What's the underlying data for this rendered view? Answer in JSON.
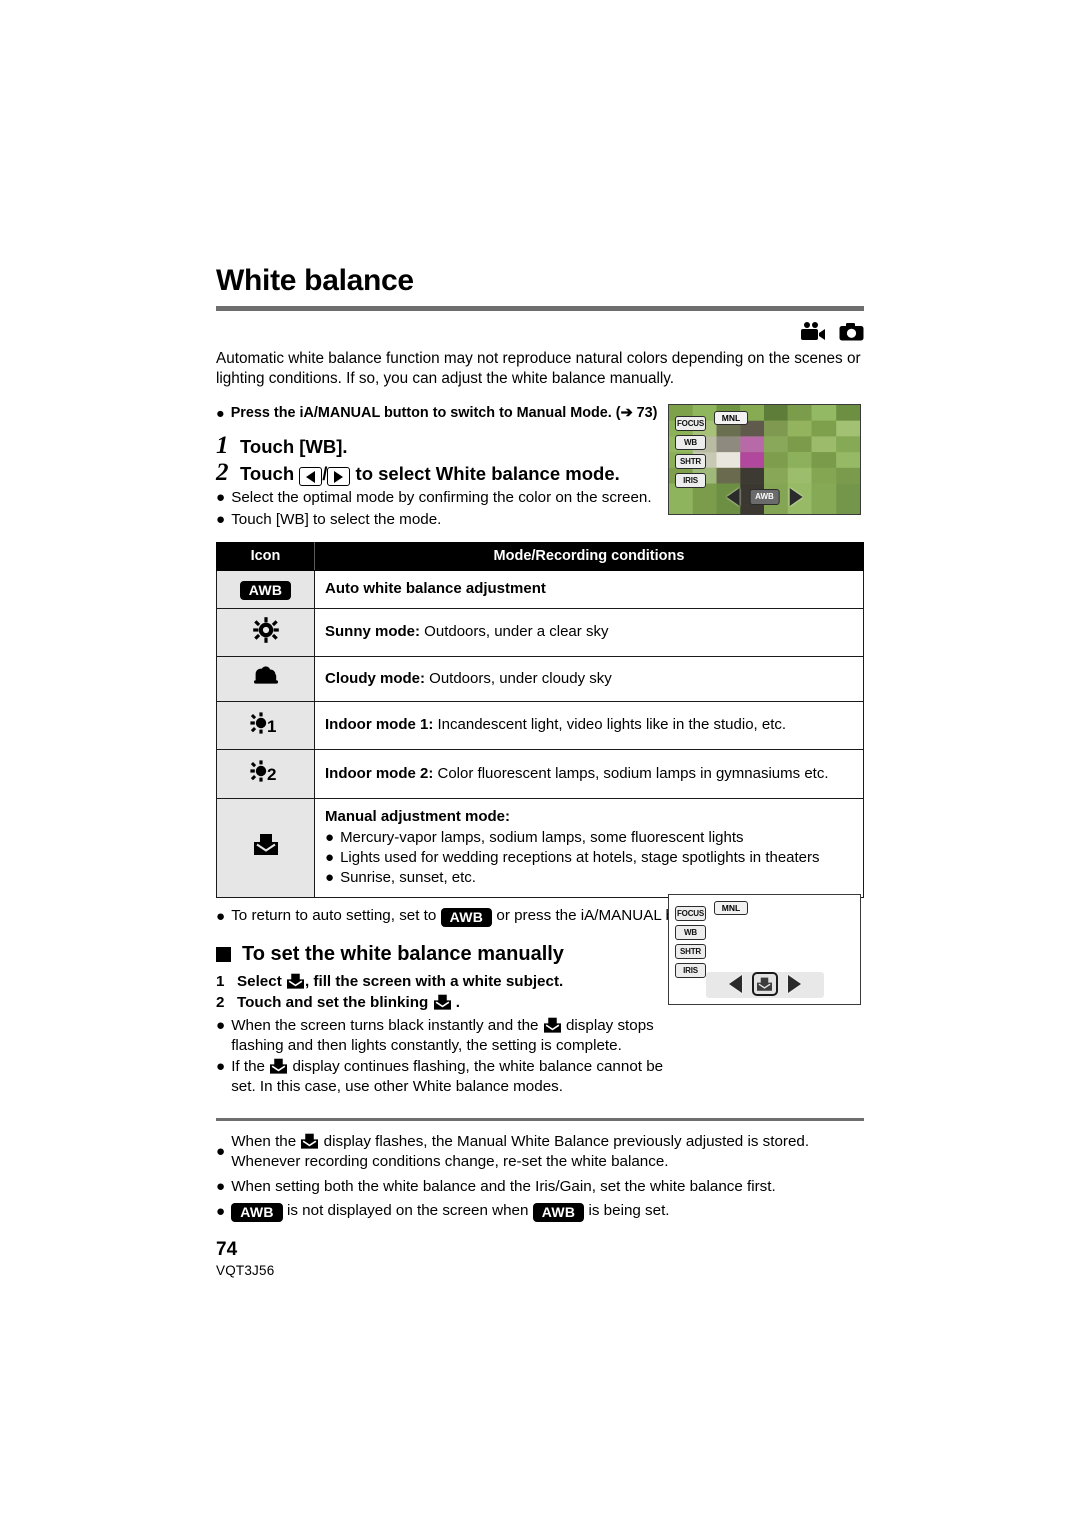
{
  "heading": {
    "title": "White balance"
  },
  "mode_icons": [
    {
      "name": "camcorder-icon",
      "label": "Motion picture recording mode"
    },
    {
      "name": "still-camera-icon",
      "label": "Still picture recording mode"
    }
  ],
  "intro": {
    "paragraph": "Automatic white balance function may not reproduce natural colors depending on the scenes or lighting conditions. If so, you can adjust the white balance manually.",
    "bullet": "Press the iA/MANUAL button to switch to Manual Mode.",
    "bullet_arrow": "➔",
    "bullet_page_ref": "73",
    "bullet_ref_open": "(",
    "bullet_ref_close": ")"
  },
  "steps": [
    {
      "num": "1",
      "text_before": "Touch [WB].",
      "text_after": ""
    },
    {
      "num": "2",
      "text_before": "Touch",
      "text_mid": "/",
      "text_after": "to select White balance mode."
    }
  ],
  "step_bullets": [
    "Select the optimal mode by confirming the color on the screen.",
    "Touch [WB] to select the mode."
  ],
  "lcd_screen_1": {
    "side_buttons": [
      "FOCUS",
      "WB",
      "SHTR",
      "IRIS"
    ],
    "mode_label": "MNL",
    "nav_left": "left-arrow",
    "nav_center": "AWB",
    "nav_right": "right-arrow"
  },
  "lcd_screen_2": {
    "side_buttons": [
      "FOCUS",
      "WB",
      "SHTR",
      "IRIS"
    ],
    "mode_label": "MNL",
    "nav_left": "left-arrow",
    "nav_center": "manual-wb-icon",
    "nav_right": "right-arrow"
  },
  "table": {
    "headers": {
      "icon": "Icon",
      "mode": "Mode/Recording conditions"
    },
    "rows": [
      {
        "icon_name": "awb-badge-icon",
        "icon_text": "AWB",
        "bold": "Auto white balance adjustment",
        "normal": ""
      },
      {
        "icon_name": "sunny-icon",
        "icon_text": "",
        "bold": "Sunny mode:",
        "normal": " Outdoors, under a clear sky"
      },
      {
        "icon_name": "cloudy-icon",
        "icon_text": "",
        "bold": "Cloudy mode:",
        "normal": " Outdoors, under cloudy sky"
      },
      {
        "icon_name": "indoor-mode-1-icon",
        "icon_text": "1",
        "bold": "Indoor mode 1:",
        "normal": " Incandescent light, video lights like in the studio, etc."
      },
      {
        "icon_name": "indoor-mode-2-icon",
        "icon_text": "2",
        "bold": "Indoor mode 2:",
        "normal": " Color fluorescent lamps, sodium lamps in gymnasiums etc."
      },
      {
        "icon_name": "manual-adjustment-icon",
        "icon_text": "",
        "bold": "Manual adjustment mode:",
        "normal": "",
        "sub_items": [
          "Mercury-vapor lamps, sodium lamps, some fluorescent lights",
          "Lights used for wedding receptions at hotels, stage spotlights in theaters",
          "Sunrise, sunset, etc."
        ]
      }
    ]
  },
  "after_table_note": {
    "before": "To return to auto setting, set to",
    "badge": "AWB",
    "after": "or press the iA/MANUAL button again."
  },
  "manual_section": {
    "heading": "To set the white balance manually",
    "steps": [
      {
        "num": "1",
        "before": "Select",
        "after": ", fill the screen with a white subject."
      },
      {
        "num": "2",
        "before": "Touch and set the blinking",
        "after": "."
      }
    ],
    "bullets": [
      {
        "before": "When the screen turns black instantly and the",
        "after": "display stops flashing and then lights constantly, the setting is complete."
      },
      {
        "before": "If the",
        "after": "display continues flashing, the white balance cannot be set. In this case, use other White balance modes."
      }
    ]
  },
  "final_notes": [
    {
      "before": "When the",
      "after": "display flashes, the Manual White Balance previously adjusted is stored. Whenever recording conditions change, re-set the white balance.",
      "type": "icon"
    },
    {
      "before": "When setting both the white balance and the Iris/Gain, set the white balance first.",
      "after": "",
      "type": "plain"
    },
    {
      "before": "is not displayed on the screen when",
      "after": "is being set.",
      "badge1": "AWB",
      "badge2": "AWB",
      "type": "double-badge"
    }
  ],
  "footer": {
    "page_number": "74",
    "document_code": "VQT3J56"
  },
  "colors": {
    "rule_gray": "#6e6e6e",
    "table_header_bg": "#000000",
    "icon_cell_bg": "#e6e6e6",
    "text": "#000000",
    "page_bg": "#ffffff"
  }
}
